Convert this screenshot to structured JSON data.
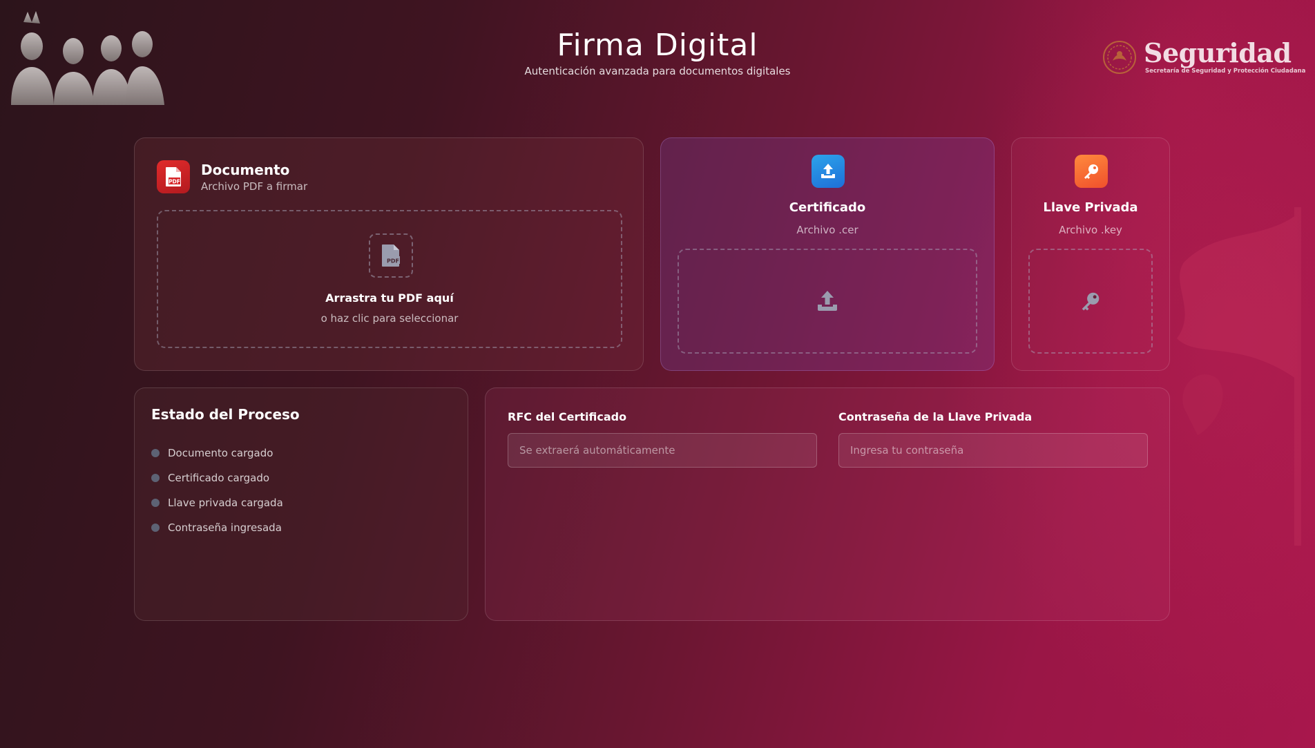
{
  "header": {
    "title": "Firma Digital",
    "subtitle": "Autenticación avanzada para documentos digitales"
  },
  "brand": {
    "name": "Seguridad",
    "subtitle": "Secretaría de Seguridad y Protección Ciudadana"
  },
  "document_card": {
    "title": "Documento",
    "subtitle": "Archivo PDF a firmar",
    "icon": "pdf-icon",
    "drop_title": "Arrastra tu PDF aquí",
    "drop_subtitle": "o haz clic para seleccionar"
  },
  "certificate_card": {
    "title": "Certificado",
    "subtitle": "Archivo .cer",
    "icon": "upload-icon"
  },
  "key_card": {
    "title": "Llave Privada",
    "subtitle": "Archivo .key",
    "icon": "key-icon"
  },
  "status": {
    "title": "Estado del Proceso",
    "items": [
      {
        "label": "Documento cargado"
      },
      {
        "label": "Certificado cargado"
      },
      {
        "label": "Llave privada cargada"
      },
      {
        "label": "Contraseña ingresada"
      }
    ]
  },
  "form": {
    "rfc_label": "RFC del Certificado",
    "rfc_placeholder": "Se extraerá automáticamente",
    "rfc_value": "",
    "password_label": "Contraseña de la Llave Privada",
    "password_placeholder": "Ingresa tu contraseña",
    "password_value": ""
  },
  "colors": {
    "background_start": "#2c141b",
    "background_end": "#a8174c",
    "pdf_badge": "#d8262a",
    "cert_badge": "#1f8fe5",
    "key_badge": "#f7683a",
    "status_dot": "#5d6274"
  }
}
